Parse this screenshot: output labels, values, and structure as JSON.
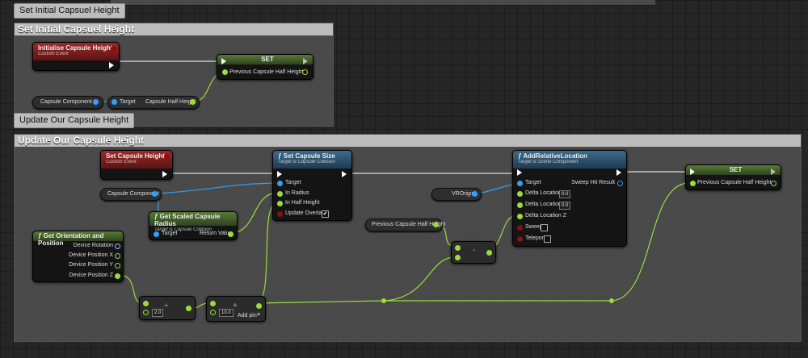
{
  "tags": {
    "top": "Set Initial Capsuel Height",
    "middle": "Update Our Capsule Height"
  },
  "comments": {
    "initial": "Set Initial Capsuel Height",
    "update": "Update Our Capsule Height"
  },
  "nodes": {
    "init_event": {
      "title": "Initialise Capsule Height",
      "subtitle": "Custom Event"
    },
    "set1": {
      "title": "SET",
      "pin": "Previous Capsule Half Height"
    },
    "capsule_var1": "Capsule Component",
    "capsule_getter": {
      "target": "Target",
      "output": "Capsule Half Height"
    },
    "update_event": {
      "title": "Set Capsule Height",
      "subtitle": "Custom Event"
    },
    "capsule_var2": "Capsule Component",
    "set_capsule_size": {
      "title": "Set Capsule Size",
      "subtitle": "Target is Capsule Collision",
      "pins": [
        "Target",
        "In Radius",
        "In Half Height",
        "Update Overlaps"
      ],
      "update_overlaps": "✔"
    },
    "scaled_radius": {
      "title": "Get Scaled Capsule Radius",
      "subtitle": "Target is Capsule Collision",
      "target": "Target",
      "output": "Return Value"
    },
    "orientation": {
      "title": "Get Orientation and Position",
      "pins": [
        "Device Rotation",
        "Device Position X",
        "Device Position Y",
        "Device Position Z"
      ]
    },
    "divide": {
      "value": "2.0",
      "op": "÷"
    },
    "add": {
      "value": "10.0",
      "op": "+",
      "add_pin": "Add pin",
      "plus": "+"
    },
    "vrorigin": "VROrigin",
    "prev_half_var": "Previous Capsule Half Height",
    "subtract": {
      "op": "-"
    },
    "add_relative": {
      "title": "AddRelativeLocation",
      "subtitle": "Target is Scene Component",
      "pins": [
        "Target",
        "Delta Location X",
        "Delta Location Y",
        "Delta Location Z",
        "Sweep",
        "Teleport"
      ],
      "dx": "0.0",
      "dy": "0.0",
      "output": "Sweep Hit Result"
    },
    "set2": {
      "title": "SET",
      "pin": "Previous Capsule Half Height"
    }
  },
  "icons": {
    "event": "event-diamond-icon",
    "function": "function-f-icon"
  },
  "colors": {
    "event_header": "#a02828",
    "function_header": "#3d6b8c",
    "set_header": "#587a36",
    "float_wire": "#9bdc3c",
    "object_wire": "#30a0ff",
    "exec_wire": "#ffffff"
  }
}
